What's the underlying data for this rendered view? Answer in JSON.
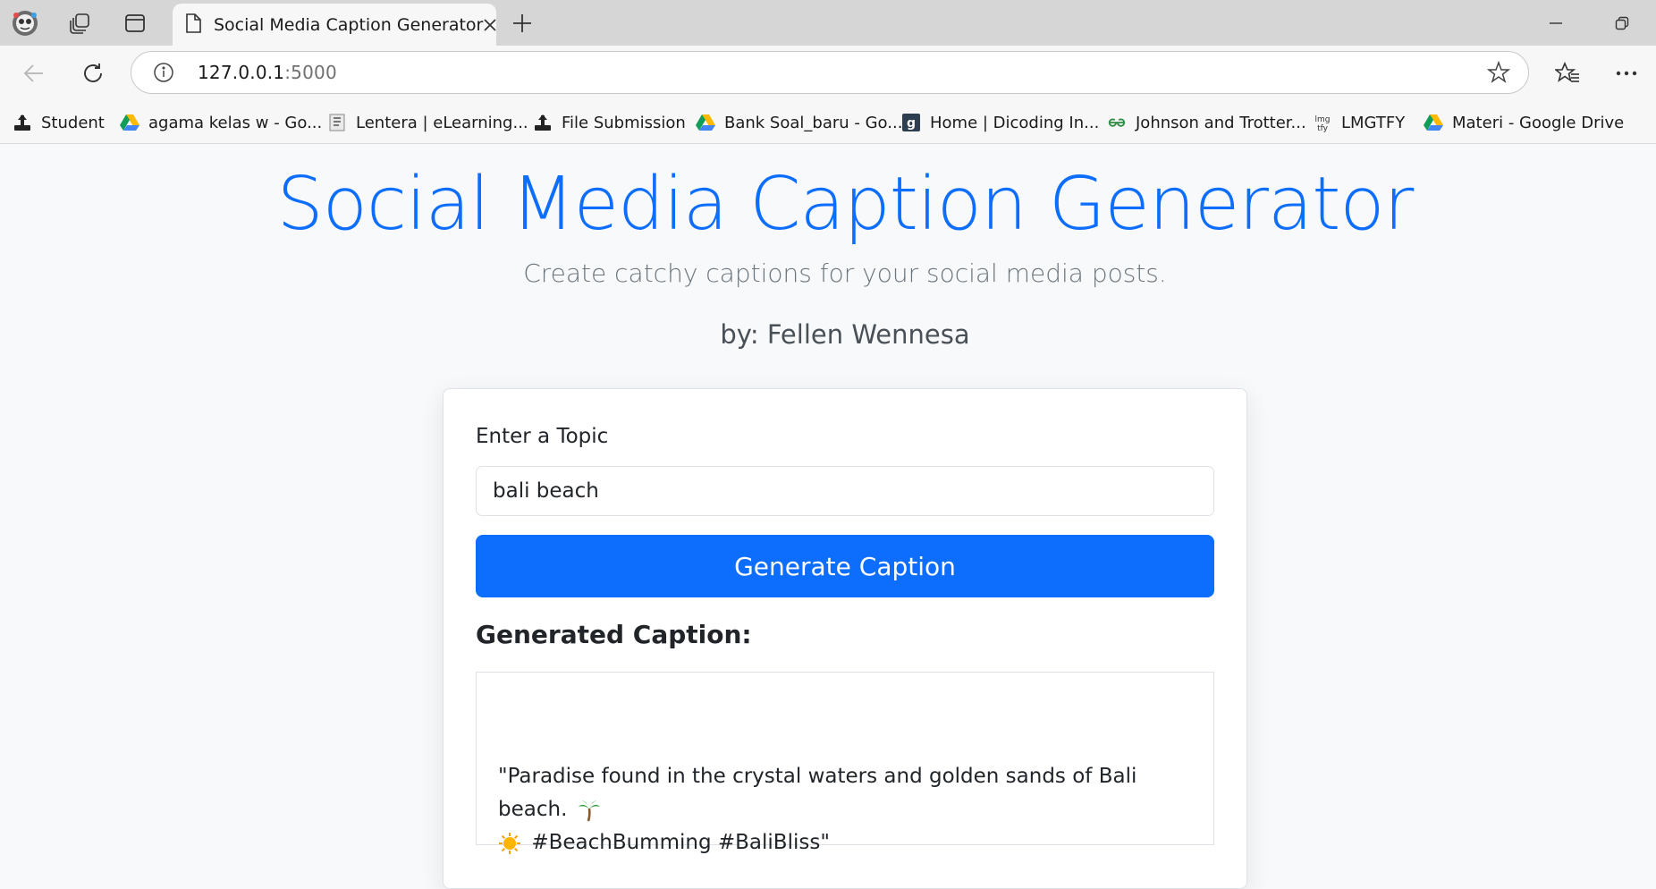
{
  "browser": {
    "tab": {
      "title": "Social Media Caption Generator"
    },
    "address": {
      "host": "127.0.0.1",
      "port": ":5000"
    },
    "bookmarks": [
      {
        "label": "Student",
        "icon": "github-icon"
      },
      {
        "label": "agama kelas w - Go...",
        "icon": "google-drive-icon"
      },
      {
        "label": "Lentera | eLearning...",
        "icon": "lentera-icon"
      },
      {
        "label": "File Submission",
        "icon": "github-icon"
      },
      {
        "label": "Bank Soal_baru - Go...",
        "icon": "google-drive-icon"
      },
      {
        "label": "Home | Dicoding In...",
        "icon": "dicoding-icon"
      },
      {
        "label": "Johnson and Trotter...",
        "icon": "geeksforgeeks-icon"
      },
      {
        "label": "LMGTFY",
        "icon": "lmgtfy-icon"
      },
      {
        "label": "Materi - Google Drive",
        "icon": "google-drive-icon"
      }
    ]
  },
  "page": {
    "title": "Social Media Caption Generator",
    "subtitle": "Create catchy captions for your social media posts.",
    "author": "by: Fellen Wennesa",
    "form": {
      "label": "Enter a Topic",
      "topic_value": "bali beach",
      "button_label": "Generate Caption"
    },
    "result": {
      "heading": "Generated Caption:",
      "caption_part1": "\"Paradise found in the crystal waters and golden sands of Bali beach.",
      "caption_part2": "#BeachBumming #BaliBliss\"",
      "emoji_1": "palm-tree-icon",
      "emoji_2": "sun-icon"
    }
  },
  "colors": {
    "accent": "#0d6efd",
    "page_bg": "#f8f9fa",
    "muted_text": "#6c757d"
  }
}
